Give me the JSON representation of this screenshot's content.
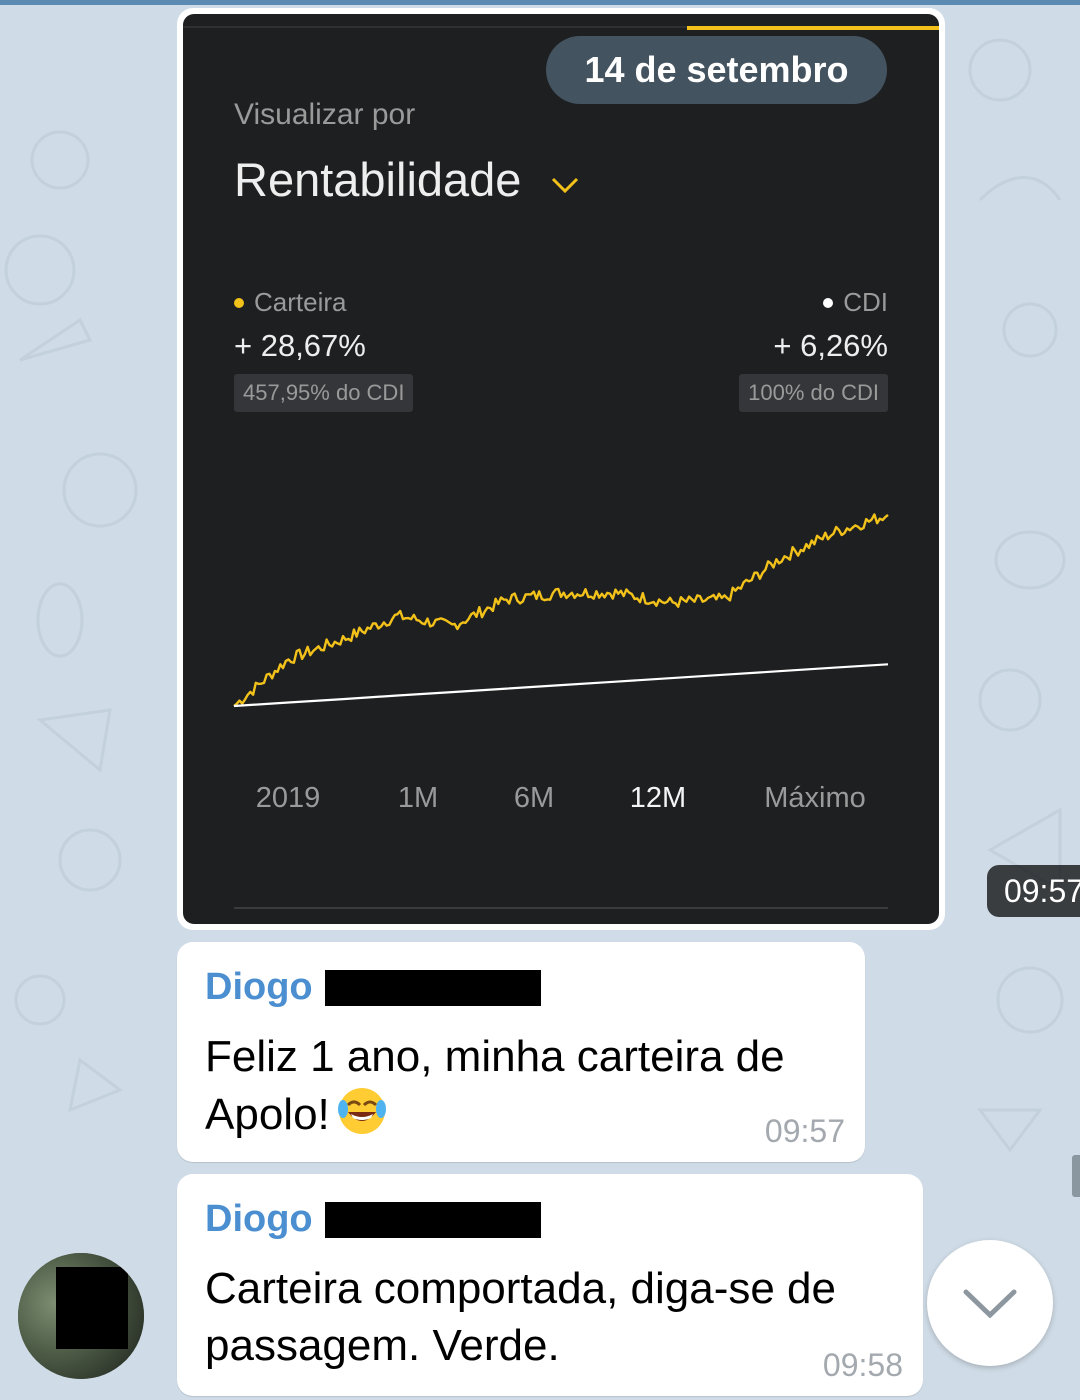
{
  "image_message": {
    "date_pill": "14 de setembro",
    "time": "09:57",
    "screenshot": {
      "view_label": "Visualizar por",
      "view_value": "Rentabilidade",
      "legend": {
        "portfolio": {
          "name": "Carteira",
          "value": "+ 28,67%",
          "badge": "457,95% do CDI",
          "color": "#f2c21b"
        },
        "benchmark": {
          "name": "CDI",
          "value": "+ 6,26%",
          "badge": "100% do CDI",
          "color": "#ffffff"
        }
      },
      "periods": [
        "2019",
        "1M",
        "6M",
        "12M",
        "Máximo"
      ],
      "active_period": "12M"
    }
  },
  "chart_data": {
    "type": "line",
    "title": "",
    "xlabel": "",
    "ylabel": "",
    "x": [
      0,
      1,
      2,
      3,
      4,
      5,
      6,
      7,
      8,
      9,
      10,
      11,
      12
    ],
    "series": [
      {
        "name": "Carteira",
        "color": "#f2c21b",
        "values": [
          0,
          7,
          10,
          13.5,
          12,
          16,
          17,
          17,
          15.5,
          16,
          22,
          26,
          28.67
        ]
      },
      {
        "name": "CDI",
        "color": "#ffffff",
        "values": [
          0,
          0.52,
          1.04,
          1.57,
          2.09,
          2.61,
          3.13,
          3.65,
          4.17,
          4.69,
          5.22,
          5.74,
          6.26
        ]
      }
    ],
    "ylim": [
      0,
      30
    ],
    "grid": false,
    "legend": "top"
  },
  "messages": [
    {
      "sender": "Diogo",
      "text_lines": [
        "Feliz 1 ano, minha carteira de",
        "Apolo!"
      ],
      "emoji": "face-with-tears-of-joy",
      "time": "09:57"
    },
    {
      "sender": "Diogo",
      "text_lines": [
        "Carteira comportada, diga-se de",
        "passagem. Verde."
      ],
      "time": "09:58"
    }
  ],
  "colors": {
    "wallpaper": "#cfdbe6",
    "sender_name": "#4c8fd1",
    "accent": "#f2c21b"
  }
}
